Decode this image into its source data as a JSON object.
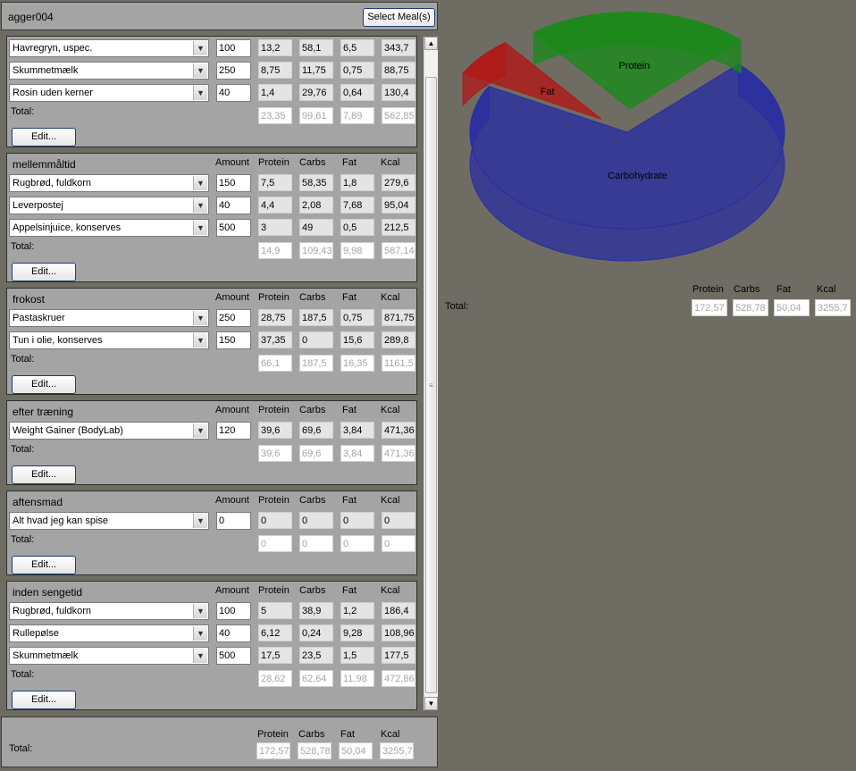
{
  "user": "agger004",
  "select_button": "Select Meal(s)",
  "labels": {
    "total": "Total:",
    "edit": "Edit...",
    "amount": "Amount",
    "protein": "Protein",
    "carbs": "Carbs",
    "fat": "Fat",
    "kcal": "Kcal"
  },
  "meals": [
    {
      "title": "",
      "items": [
        {
          "food": "Havregryn, uspec.",
          "amount": "100",
          "protein": "13,2",
          "carbs": "58,1",
          "fat": "6,5",
          "kcal": "343,7"
        },
        {
          "food": "Skummetmælk",
          "amount": "250",
          "protein": "8,75",
          "carbs": "11,75",
          "fat": "0,75",
          "kcal": "88,75"
        },
        {
          "food": "Rosin uden kerner",
          "amount": "40",
          "protein": "1,4",
          "carbs": "29,76",
          "fat": "0,64",
          "kcal": "130,4"
        }
      ],
      "total": {
        "protein": "23,35",
        "carbs": "99,61",
        "fat": "7,89",
        "kcal": "562,85"
      }
    },
    {
      "title": "mellemmåltid",
      "items": [
        {
          "food": "Rugbrød, fuldkorn",
          "amount": "150",
          "protein": "7,5",
          "carbs": "58,35",
          "fat": "1,8",
          "kcal": "279,6"
        },
        {
          "food": "Leverpostej",
          "amount": "40",
          "protein": "4,4",
          "carbs": "2,08",
          "fat": "7,68",
          "kcal": "95,04"
        },
        {
          "food": "Appelsinjuice, konserves",
          "amount": "500",
          "protein": "3",
          "carbs": "49",
          "fat": "0,5",
          "kcal": "212,5"
        }
      ],
      "total": {
        "protein": "14,9",
        "carbs": "109,43",
        "fat": "9,98",
        "kcal": "587,14"
      }
    },
    {
      "title": "frokost",
      "items": [
        {
          "food": "Pastaskruer",
          "amount": "250",
          "protein": "28,75",
          "carbs": "187,5",
          "fat": "0,75",
          "kcal": "871,75"
        },
        {
          "food": "Tun i olie, konserves",
          "amount": "150",
          "protein": "37,35",
          "carbs": "0",
          "fat": "15,6",
          "kcal": "289,8"
        }
      ],
      "total": {
        "protein": "66,1",
        "carbs": "187,5",
        "fat": "16,35",
        "kcal": "1161,5"
      }
    },
    {
      "title": "efter træning",
      "items": [
        {
          "food": "Weight Gainer (BodyLab)",
          "amount": "120",
          "protein": "39,6",
          "carbs": "69,6",
          "fat": "3,84",
          "kcal": "471,36"
        }
      ],
      "total": {
        "protein": "39,6",
        "carbs": "69,6",
        "fat": "3,84",
        "kcal": "471,36"
      }
    },
    {
      "title": "aftensmad",
      "items": [
        {
          "food": "Alt hvad jeg kan spise",
          "amount": "0",
          "protein": "0",
          "carbs": "0",
          "fat": "0",
          "kcal": "0"
        }
      ],
      "total": {
        "protein": "0",
        "carbs": "0",
        "fat": "0",
        "kcal": "0"
      }
    },
    {
      "title": "inden sengetid",
      "items": [
        {
          "food": "Rugbrød, fuldkorn",
          "amount": "100",
          "protein": "5",
          "carbs": "38,9",
          "fat": "1,2",
          "kcal": "186,4"
        },
        {
          "food": "Rullepølse",
          "amount": "40",
          "protein": "6,12",
          "carbs": "0,24",
          "fat": "9,28",
          "kcal": "108,96"
        },
        {
          "food": "Skummetmælk",
          "amount": "500",
          "protein": "17,5",
          "carbs": "23,5",
          "fat": "1,5",
          "kcal": "177,5"
        }
      ],
      "total": {
        "protein": "28,62",
        "carbs": "62,64",
        "fat": "11,98",
        "kcal": "472,86"
      }
    }
  ],
  "grand_total": {
    "protein": "172,57",
    "carbs": "528,78",
    "fat": "50,04",
    "kcal": "3255,7"
  },
  "colors": {
    "carbohydrate": "#2a2ea0",
    "fat": "#b01818",
    "protein": "#1a8a1a"
  },
  "chart_data": {
    "type": "pie",
    "categories": [
      "Carbohydrate",
      "Fat",
      "Protein"
    ],
    "values": [
      528.78,
      50.04,
      172.57
    ],
    "slice_labels": [
      "Carbohydrate",
      "Fat",
      "Protein"
    ],
    "style": "3d-exploded"
  }
}
